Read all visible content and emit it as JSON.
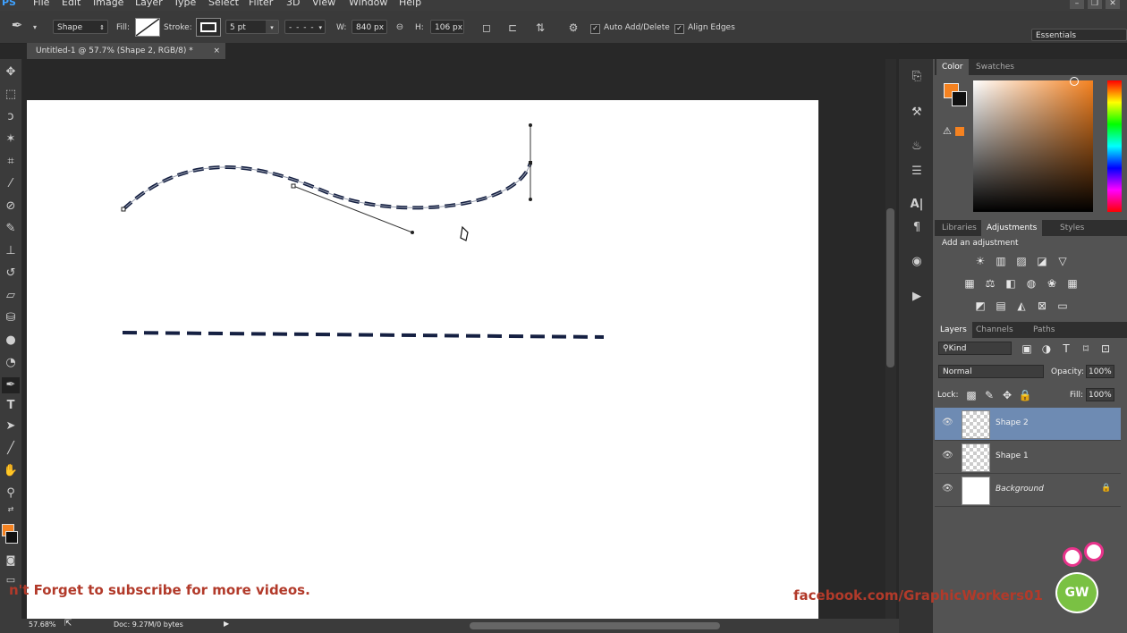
{
  "menu": {
    "app_badge": "PS",
    "items": [
      "File",
      "Edit",
      "Image",
      "Layer",
      "Type",
      "Select",
      "Filter",
      "3D",
      "View",
      "Window",
      "Help"
    ]
  },
  "options_bar": {
    "mode": "Shape",
    "fill_label": "Fill:",
    "stroke_label": "Stroke:",
    "stroke_width": "5 pt",
    "w_label": "W:",
    "w_value": "840 px",
    "h_label": "H:",
    "h_value": "106 px",
    "auto_add_delete": "Auto Add/Delete",
    "align_edges": "Align Edges",
    "workspace": "Essentials"
  },
  "document_tab": {
    "title": "Untitled-1 @ 57.7% (Shape 2, RGB/8) *",
    "close": "×"
  },
  "status": {
    "zoom": "57.68%",
    "doc": "Doc: 9.27M/0 bytes"
  },
  "color_panel": {
    "tabs": [
      "Color",
      "Swatches"
    ],
    "foreground": "#f58220",
    "background": "#111111"
  },
  "adjustments_panel": {
    "tabs": [
      "Libraries",
      "Adjustments",
      "Styles"
    ],
    "heading": "Add an adjustment"
  },
  "layers_panel": {
    "tabs": [
      "Layers",
      "Channels",
      "Paths"
    ],
    "filter": "Kind",
    "blend_mode": "Normal",
    "opacity_label": "Opacity:",
    "opacity_value": "100%",
    "lock_label": "Lock:",
    "fill_label": "Fill:",
    "fill_value": "100%",
    "layers": [
      {
        "name": "Shape 2",
        "selected": true
      },
      {
        "name": "Shape 1",
        "selected": false
      },
      {
        "name": "Background",
        "selected": false
      }
    ]
  },
  "overlay": {
    "subscribe": "n't Forget to subscribe for more videos.",
    "facebook": "facebook.com/GraphicWorkers01",
    "logo": "GW"
  },
  "colors": {
    "accent_orange": "#f58220",
    "overlay_red": "#b23a2a",
    "stroke_navy": "#152042",
    "layer_selected": "#6e8bb3"
  }
}
